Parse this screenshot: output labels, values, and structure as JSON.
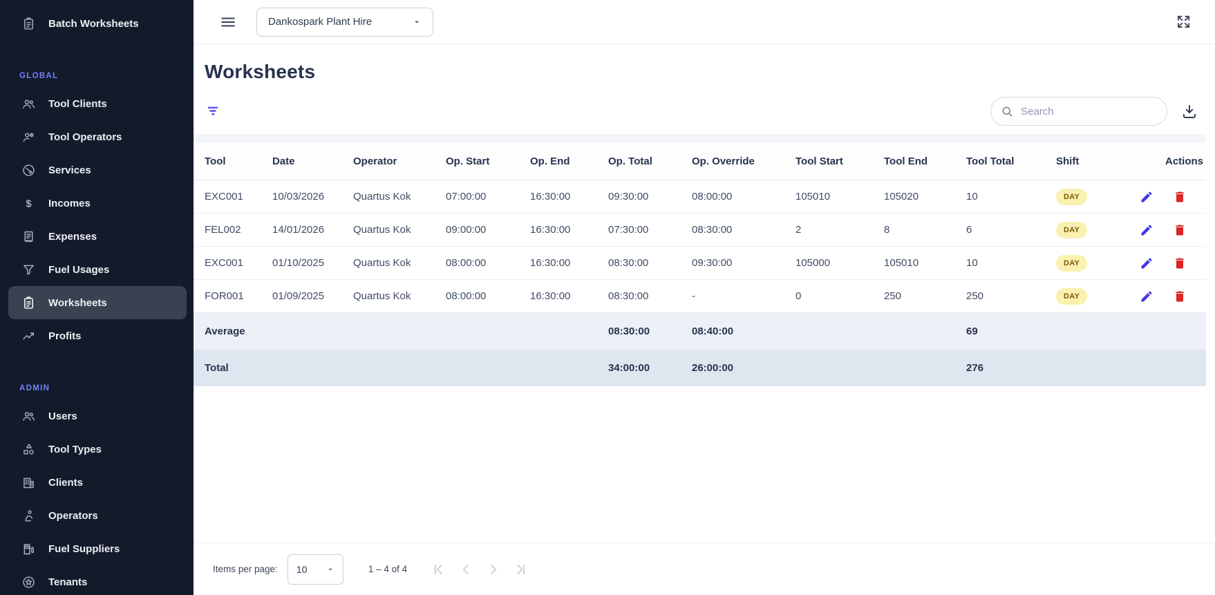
{
  "topbar": {
    "tenant": "Dankospark Plant Hire"
  },
  "page": {
    "title": "Worksheets"
  },
  "toolbar": {
    "search_placeholder": "Search"
  },
  "sidebar": {
    "batch": {
      "label": "Batch Worksheets"
    },
    "sections": [
      {
        "label": "GLOBAL",
        "items": [
          {
            "label": "Tool Clients",
            "icon": "group-icon"
          },
          {
            "label": "Tool Operators",
            "icon": "operator-gear-icon"
          },
          {
            "label": "Services",
            "icon": "service-icon"
          },
          {
            "label": "Incomes",
            "icon": "dollar-icon"
          },
          {
            "label": "Expenses",
            "icon": "receipt-icon"
          },
          {
            "label": "Fuel Usages",
            "icon": "funnel-icon"
          },
          {
            "label": "Worksheets",
            "icon": "clipboard-icon",
            "active": true
          },
          {
            "label": "Profits",
            "icon": "trending-up-icon"
          }
        ]
      },
      {
        "label": "ADMIN",
        "items": [
          {
            "label": "Users",
            "icon": "group-icon"
          },
          {
            "label": "Tool Types",
            "icon": "shapes-icon"
          },
          {
            "label": "Clients",
            "icon": "building-icon"
          },
          {
            "label": "Operators",
            "icon": "person-icon"
          },
          {
            "label": "Fuel Suppliers",
            "icon": "fuel-pump-icon"
          },
          {
            "label": "Tenants",
            "icon": "star-badge-icon"
          }
        ]
      }
    ]
  },
  "table": {
    "columns": [
      "Tool",
      "Date",
      "Operator",
      "Op. Start",
      "Op. End",
      "Op. Total",
      "Op. Override",
      "Tool Start",
      "Tool End",
      "Tool Total",
      "Shift",
      "Actions"
    ],
    "rows": [
      {
        "tool": "EXC001",
        "date": "10/03/2026",
        "operator": "Quartus Kok",
        "op_start": "07:00:00",
        "op_end": "16:30:00",
        "op_total": "09:30:00",
        "op_override": "08:00:00",
        "tool_start": "105010",
        "tool_end": "105020",
        "tool_total": "10",
        "shift": "DAY"
      },
      {
        "tool": "FEL002",
        "date": "14/01/2026",
        "operator": "Quartus Kok",
        "op_start": "09:00:00",
        "op_end": "16:30:00",
        "op_total": "07:30:00",
        "op_override": "08:30:00",
        "tool_start": "2",
        "tool_end": "8",
        "tool_total": "6",
        "shift": "DAY"
      },
      {
        "tool": "EXC001",
        "date": "01/10/2025",
        "operator": "Quartus Kok",
        "op_start": "08:00:00",
        "op_end": "16:30:00",
        "op_total": "08:30:00",
        "op_override": "09:30:00",
        "tool_start": "105000",
        "tool_end": "105010",
        "tool_total": "10",
        "shift": "DAY"
      },
      {
        "tool": "FOR001",
        "date": "01/09/2025",
        "operator": "Quartus Kok",
        "op_start": "08:00:00",
        "op_end": "16:30:00",
        "op_total": "08:30:00",
        "op_override": "-",
        "tool_start": "0",
        "tool_end": "250",
        "tool_total": "250",
        "shift": "DAY"
      }
    ],
    "summary": {
      "average": {
        "label": "Average",
        "op_total": "08:30:00",
        "op_override": "08:40:00",
        "tool_total": "69"
      },
      "total": {
        "label": "Total",
        "op_total": "34:00:00",
        "op_override": "26:00:00",
        "tool_total": "276"
      }
    }
  },
  "pagination": {
    "items_per_page_label": "Items per page:",
    "items_per_page_value": "10",
    "range_label": "1 – 4 of 4"
  },
  "colors": {
    "sidebar_bg": "#131B2B",
    "section_label": "#7381F9",
    "accent": "#584FF2",
    "edit_icon": "#4036E4",
    "delete_icon": "#DC2626",
    "badge_bg": "#FAF0B0",
    "badge_text": "#7A5C0B",
    "average_row_bg": "#EDF1F7",
    "total_row_bg": "#DFE6EF"
  }
}
